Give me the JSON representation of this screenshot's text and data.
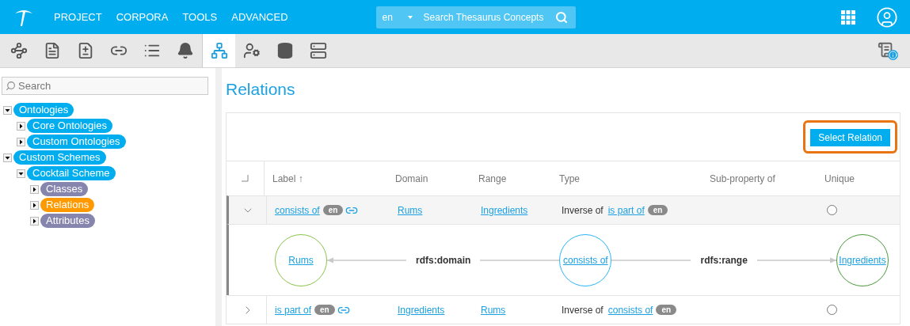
{
  "topbar": {
    "nav": [
      "PROJECT",
      "CORPORA",
      "TOOLS",
      "ADVANCED"
    ],
    "search": {
      "lang": "en",
      "placeholder": "Search Thesaurus Concepts"
    }
  },
  "toolbar": [
    {
      "kind": "hierarchy",
      "selected": false
    },
    {
      "kind": "starred-doc",
      "selected": false
    },
    {
      "kind": "compare",
      "selected": false
    },
    {
      "kind": "link",
      "selected": false
    },
    {
      "kind": "list",
      "selected": false
    },
    {
      "kind": "bell",
      "selected": false
    },
    {
      "kind": "network",
      "selected": true
    },
    {
      "kind": "user-settings",
      "selected": false
    },
    {
      "kind": "database",
      "selected": false
    },
    {
      "kind": "server",
      "selected": false
    }
  ],
  "sidebar": {
    "search": {
      "placeholder": "Search"
    },
    "tree": [
      {
        "label": "Ontologies",
        "color": "#00aeef",
        "expanded": true,
        "children": [
          {
            "label": "Core Ontologies",
            "color": "#00aeef",
            "expanded": false
          },
          {
            "label": "Custom Ontologies",
            "color": "#00aeef",
            "expanded": false
          }
        ]
      },
      {
        "label": "Custom Schemes",
        "color": "#00aeef",
        "expanded": true,
        "children": [
          {
            "label": "Cocktail Scheme",
            "color": "#00aeef",
            "expanded": true,
            "children": [
              {
                "label": "Classes",
                "color": "#8585ad",
                "expanded": false
              },
              {
                "label": "Relations",
                "color": "#ff9900",
                "expanded": false
              },
              {
                "label": "Attributes",
                "color": "#8585ad",
                "expanded": false
              }
            ]
          }
        ]
      }
    ]
  },
  "main": {
    "title": "Relations",
    "select_button": {
      "label": "Select Relation",
      "highlighted": true
    },
    "table": {
      "select_all_checked": false,
      "columns": [
        "Label ↑",
        "Domain",
        "Range",
        "Type",
        "Sub-property of",
        "Unique"
      ],
      "rows": [
        {
          "expanded": true,
          "label": "consists of",
          "label_lang": "en",
          "domain": "Rums",
          "range": "Ingredients",
          "type_prefix": "Inverse of",
          "type_link": "is part of",
          "type_lang": "en",
          "unique": false,
          "detail": {
            "domain_node": "Rums",
            "domain_edge": "rdfs:domain",
            "center_node": "consists of",
            "range_edge": "rdfs:range",
            "range_node": "Ingredients"
          }
        },
        {
          "expanded": false,
          "label": "is part of",
          "label_lang": "en",
          "domain": "Ingredients",
          "range": "Rums",
          "type_prefix": "Inverse of",
          "type_link": "consists of",
          "type_lang": "en",
          "unique": false
        }
      ]
    }
  }
}
